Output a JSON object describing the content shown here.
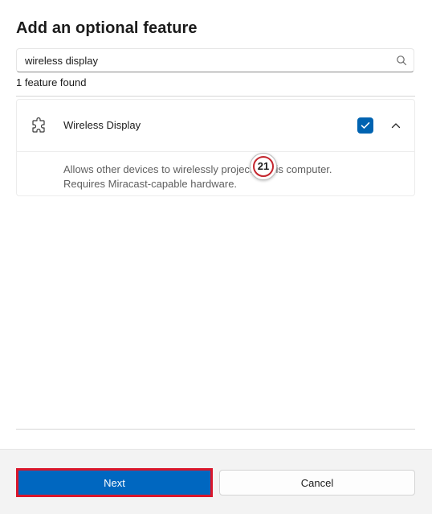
{
  "dialog": {
    "title": "Add an optional feature"
  },
  "search": {
    "value": "wireless display",
    "icon": "search-icon"
  },
  "results": {
    "count_text": "1 feature found"
  },
  "feature": {
    "name": "Wireless Display",
    "icon": "puzzle-icon",
    "checked": true,
    "expanded": true,
    "description_line1": "Allows other devices to wirelessly project to this computer.",
    "description_line2": "Requires Miracast-capable hardware."
  },
  "annotation": {
    "step_number": "21",
    "ring_color": "#c4262e"
  },
  "footer": {
    "next_label": "Next",
    "cancel_label": "Cancel"
  },
  "colors": {
    "accent": "#0067c0",
    "highlight": "#d9162b"
  }
}
